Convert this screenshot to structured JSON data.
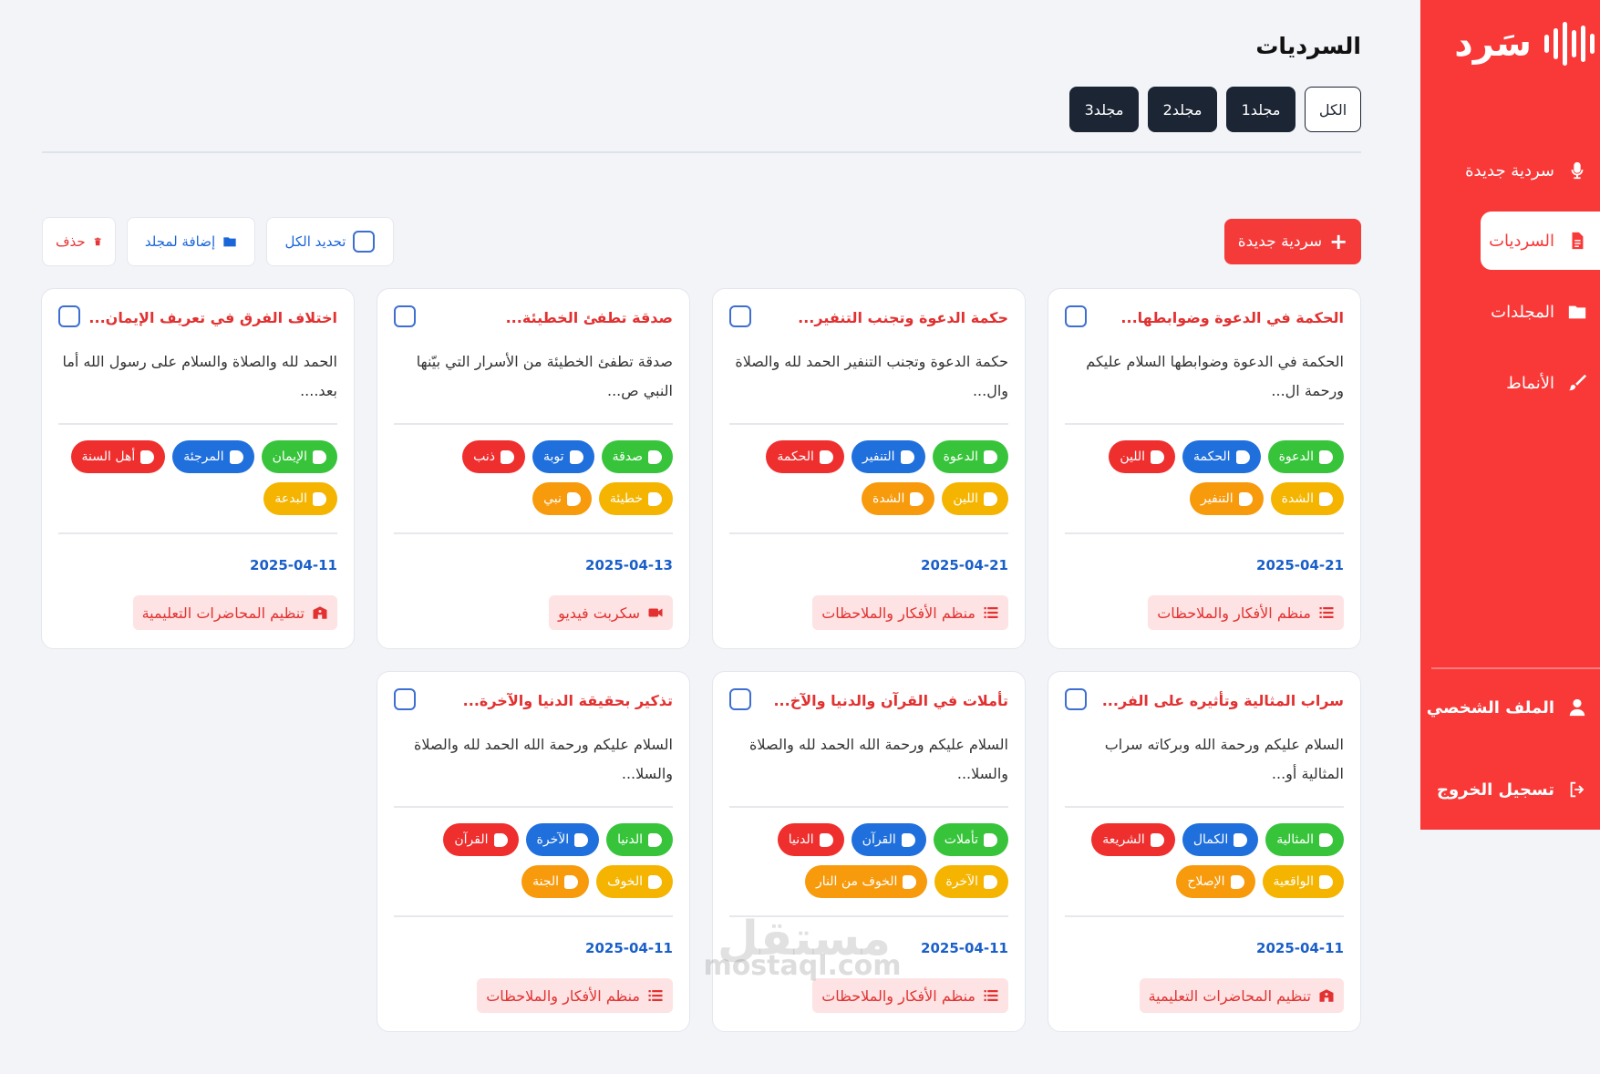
{
  "brand": {
    "logo_text": "سَرد",
    "accent": "#f93838"
  },
  "sidebar": {
    "items": [
      {
        "label": "سردية جديدة",
        "icon": "microphone-icon"
      },
      {
        "label": "السرديات",
        "icon": "document-icon",
        "active": true
      },
      {
        "label": "المجلدات",
        "icon": "folder-icon"
      },
      {
        "label": "الأنماط",
        "icon": "brush-icon"
      }
    ],
    "profile_label": "الملف الشخصي",
    "logout_label": "تسجيل الخروج"
  },
  "header": {
    "title": "السرديات",
    "folder_tabs": [
      "الكل",
      "مجلد1",
      "مجلد2",
      "مجلد3"
    ]
  },
  "actions": {
    "new_label": "سردية جديدة",
    "select_all_label": "تحديد الكل",
    "add_to_folder_label": "إضافة لمجلد",
    "delete_label": "حذف"
  },
  "cards": [
    {
      "title": "الحكمة في الدعوة وضوابطها...",
      "body": "الحكمة في الدعوة وضوابطها السلام عليكم ورحمة ال...",
      "tags": [
        {
          "label": "الدعوة",
          "color": "#37c43b"
        },
        {
          "label": "الحكمة",
          "color": "#1f6fdc"
        },
        {
          "label": "اللين",
          "color": "#ef2e2e"
        },
        {
          "label": "الشدة",
          "color": "#f4b400"
        },
        {
          "label": "التنفير",
          "color": "#f79a0c"
        }
      ],
      "date": "2025-04-21",
      "category": "منظم الأفكار والملاحظات",
      "category_icon": "list-icon"
    },
    {
      "title": "حكمة الدعوة وتجنب التنفير...",
      "body": "حكمة الدعوة وتجنب التنفير الحمد لله والصلاة وال...",
      "tags": [
        {
          "label": "الدعوة",
          "color": "#37c43b"
        },
        {
          "label": "التنفير",
          "color": "#1f6fdc"
        },
        {
          "label": "الحكمة",
          "color": "#ef2e2e"
        },
        {
          "label": "اللين",
          "color": "#f4b400"
        },
        {
          "label": "الشدة",
          "color": "#f79a0c"
        }
      ],
      "date": "2025-04-21",
      "category": "منظم الأفكار والملاحظات",
      "category_icon": "list-icon"
    },
    {
      "title": "صدقة تطفئ الخطيئة...",
      "body": "صدقة تطفئ الخطيئة من الأسرار التي بيّنها النبي ص...",
      "tags": [
        {
          "label": "صدقة",
          "color": "#37c43b"
        },
        {
          "label": "توبة",
          "color": "#1f6fdc"
        },
        {
          "label": "ذنب",
          "color": "#ef2e2e"
        },
        {
          "label": "خطيئة",
          "color": "#f4b400"
        },
        {
          "label": "نبي",
          "color": "#f79a0c"
        }
      ],
      "date": "2025-04-13",
      "category": "سكربت فيديو",
      "category_icon": "video-icon"
    },
    {
      "title": "اختلاف الفرق في تعريف الإيمان...",
      "body": "الحمد لله والصلاة والسلام على رسول الله أما بعد....",
      "tags": [
        {
          "label": "الإيمان",
          "color": "#37c43b"
        },
        {
          "label": "المرجئة",
          "color": "#1f6fdc"
        },
        {
          "label": "أهل السنة",
          "color": "#ef2e2e"
        },
        {
          "label": "البدعة",
          "color": "#f4b400"
        }
      ],
      "date": "2025-04-11",
      "category": "تنظيم المحاضرات التعليمية",
      "category_icon": "school-icon"
    },
    {
      "title": "سراب المثالية وتأثيره على الفر...",
      "body": "السلام عليكم ورحمة الله وبركاته سراب المثالية أو...",
      "tags": [
        {
          "label": "المثالية",
          "color": "#37c43b"
        },
        {
          "label": "الكمال",
          "color": "#1f6fdc"
        },
        {
          "label": "الشريعة",
          "color": "#ef2e2e"
        },
        {
          "label": "الواقعية",
          "color": "#f4b400"
        },
        {
          "label": "الإصلاح",
          "color": "#f79a0c"
        }
      ],
      "date": "2025-04-11",
      "category": "تنظيم المحاضرات التعليمية",
      "category_icon": "school-icon"
    },
    {
      "title": "تأملات في القرآن والدنيا والآخ...",
      "body": "السلام عليكم ورحمة الله الحمد لله والصلاة والسلا...",
      "tags": [
        {
          "label": "تأملات",
          "color": "#37c43b"
        },
        {
          "label": "القرآن",
          "color": "#1f6fdc"
        },
        {
          "label": "الدنيا",
          "color": "#ef2e2e"
        },
        {
          "label": "الآخرة",
          "color": "#f4b400"
        },
        {
          "label": "الخوف من النار",
          "color": "#f79a0c"
        }
      ],
      "date": "2025-04-11",
      "category": "منظم الأفكار والملاحظات",
      "category_icon": "list-icon"
    },
    {
      "title": "تذكير بحقيقة الدنيا والآخرة...",
      "body": "السلام عليكم ورحمة الله الحمد لله والصلاة والسلا...",
      "tags": [
        {
          "label": "الدنيا",
          "color": "#37c43b"
        },
        {
          "label": "الآخرة",
          "color": "#1f6fdc"
        },
        {
          "label": "القرآن",
          "color": "#ef2e2e"
        },
        {
          "label": "الخوف",
          "color": "#f4b400"
        },
        {
          "label": "الجنة",
          "color": "#f79a0c"
        }
      ],
      "date": "2025-04-11",
      "category": "منظم الأفكار والملاحظات",
      "category_icon": "list-icon"
    }
  ],
  "watermark": {
    "arabic": "مستقل",
    "latin": "mostaql.com"
  }
}
